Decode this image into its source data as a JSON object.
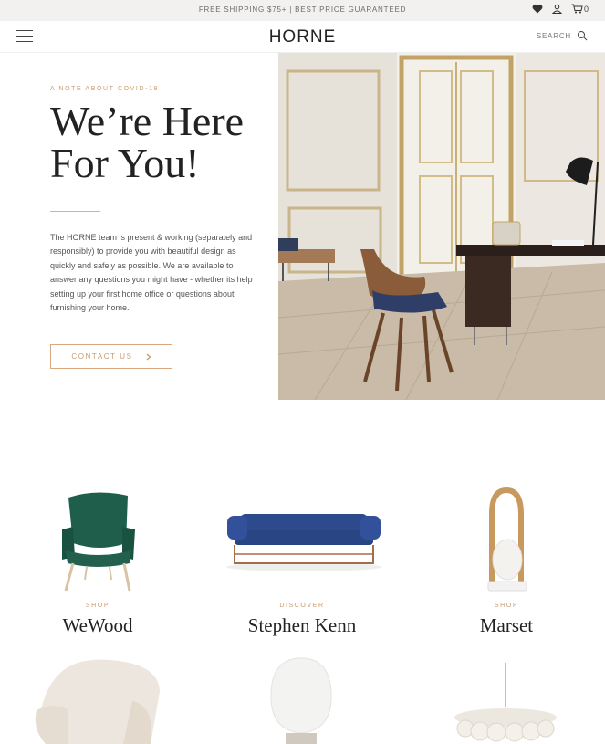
{
  "topbar": {
    "promo": "FREE SHIPPING $75+ | BEST PRICE GUARANTEED",
    "icons": [
      "heart-icon",
      "user-icon",
      "cart-icon"
    ],
    "cart_count": "0"
  },
  "header": {
    "logo": "HORNE",
    "search_label": "SEARCH"
  },
  "hero": {
    "eyebrow": "A NOTE ABOUT COVID-19",
    "title_line1": "We’re Here",
    "title_line2": "For You!",
    "body": "The HORNE team is present & working (separately and responsibly) to provide you with beautiful design as quickly and safely as possible. We are available to answer any questions you might have - whether its help setting up your first home office or questions about furnishing your home.",
    "cta_label": "CONTACT US"
  },
  "products": [
    {
      "kicker": "SHOP",
      "name": "WeWood"
    },
    {
      "kicker": "DISCOVER",
      "name": "Stephen Kenn"
    },
    {
      "kicker": "SHOP",
      "name": "Marset"
    }
  ],
  "colors": {
    "accent": "#c89b6d",
    "topbar_bg": "#f2f1ef",
    "text_dark": "#222222"
  }
}
